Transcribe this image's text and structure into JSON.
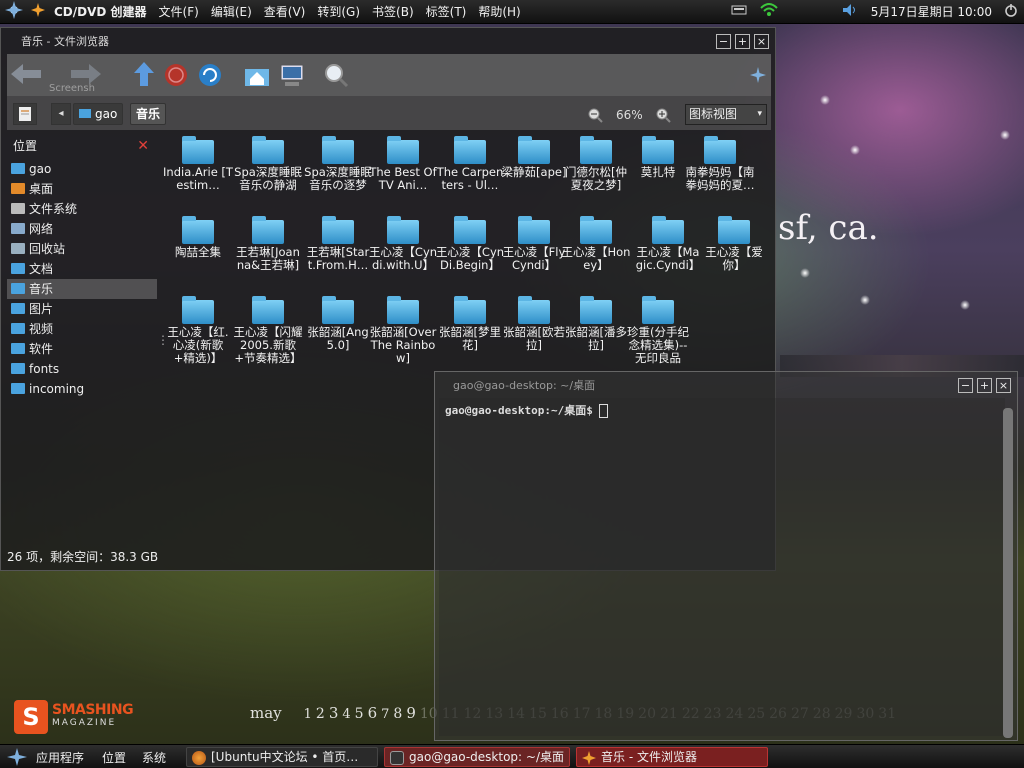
{
  "top_panel": {
    "cddvd": "CD/DVD 创建器",
    "menu": [
      "文件(F)",
      "编辑(E)",
      "查看(V)",
      "转到(G)",
      "书签(B)",
      "标签(T)",
      "帮助(H)"
    ],
    "clock": "5月17日星期日 10:00"
  },
  "wallpaper": {
    "text": "sf, ca.",
    "brand_a": "SMASHING",
    "brand_b": "MAGAZINE",
    "month": "may",
    "days": [
      "1",
      "2",
      "3",
      "4",
      "5",
      "6",
      "7",
      "8",
      "9",
      "10",
      "11",
      "12",
      "13",
      "14",
      "15",
      "16",
      "17",
      "18",
      "19",
      "20",
      "21",
      "22",
      "23",
      "24",
      "25",
      "26",
      "27",
      "28",
      "29",
      "30",
      "31"
    ]
  },
  "file_browser": {
    "title": "音乐 - 文件浏览器",
    "toolbar": {
      "ghost_text": "Screensh"
    },
    "location": {
      "home_btn": "gao",
      "current_btn": "音乐",
      "zoom": "66%",
      "view_mode": "图标视图"
    },
    "sidebar": {
      "header": "位置",
      "items": [
        {
          "label": "gao",
          "icon": "home-folder-icon",
          "color": "#4aa3df"
        },
        {
          "label": "桌面",
          "icon": "desktop-icon",
          "color": "#e38a2a"
        },
        {
          "label": "文件系统",
          "icon": "drive-icon",
          "color": "#bbbbbb"
        },
        {
          "label": "网络",
          "icon": "network-icon",
          "color": "#88aacc"
        },
        {
          "label": "回收站",
          "icon": "trash-icon",
          "color": "#9ab0c0"
        },
        {
          "label": "文档",
          "icon": "folder-icon",
          "color": "#4aa3df"
        },
        {
          "label": "音乐",
          "icon": "folder-icon",
          "color": "#4aa3df"
        },
        {
          "label": "图片",
          "icon": "folder-icon",
          "color": "#4aa3df"
        },
        {
          "label": "视频",
          "icon": "folder-icon",
          "color": "#4aa3df"
        },
        {
          "label": "软件",
          "icon": "folder-icon",
          "color": "#4aa3df"
        },
        {
          "label": "fonts",
          "icon": "folder-icon",
          "color": "#4aa3df"
        },
        {
          "label": "incoming",
          "icon": "folder-icon",
          "color": "#4aa3df"
        }
      ]
    },
    "folders": [
      "India.Arie [Testim…",
      "Spa深度睡眠音乐の静湖",
      "Spa深度睡眠音乐の逐梦",
      "The Best Of TV Ani…",
      "The Carpenters - Ul…",
      "梁静茹[ape]",
      "门德尔松[仲夏夜之梦]",
      "莫扎特",
      "南拳妈妈【南拳妈妈的夏…",
      "陶喆全集",
      "王若琳[Joanna&王若琳]",
      "王若琳[Start.From.H…",
      "王心凌【Cyndi.with.U】",
      "王心凌【CynDi.Begin】",
      "王心凌【Fly Cyndi】",
      "王心凌【Honey】",
      "王心凌【Magic.Cyndi】",
      "王心凌【爱你】",
      "王心凌【红.心凌(新歌+精选)】",
      "王心凌【闪耀2005.新歌+节奏精选】",
      "张韶涵[Ang 5.0]",
      "张韶涵[Over The Rainbow]",
      "张韶涵[梦里花]",
      "张韶涵[欧若拉]",
      "张韶涵[潘多拉]",
      "珍重(分手纪念精选集)--无印良品"
    ],
    "status": "26 项，剩余空间：38.3 GB"
  },
  "terminal": {
    "title": "gao@gao-desktop: ~/桌面",
    "prompt": "gao@gao-desktop:~/桌面$"
  },
  "bottom_panel": {
    "apps": "应用程序",
    "places": "位置",
    "system": "系统",
    "tasks": [
      "[Ubuntu中文论坛 • 首页…",
      "gao@gao-desktop: ~/桌面",
      "音乐 - 文件浏览器"
    ]
  }
}
